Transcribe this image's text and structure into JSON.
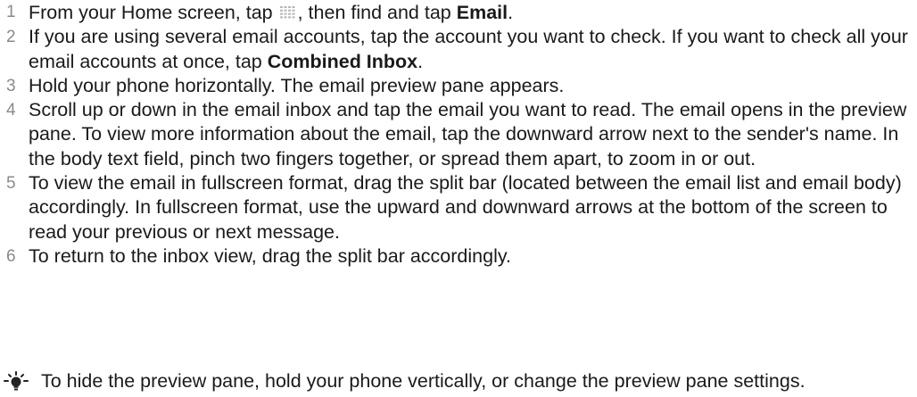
{
  "steps": [
    {
      "number": "1",
      "before_icon": "From your Home screen, tap ",
      "icon": "app-grid-icon",
      "after_icon": ", then find and tap ",
      "bold": "Email",
      "end": "."
    },
    {
      "number": "2",
      "text": "If you are using several email accounts, tap the account you want to check. If you want to check all your email accounts at once, tap ",
      "bold": "Combined Inbox",
      "end": "."
    },
    {
      "number": "3",
      "text": "Hold your phone horizontally. The email preview pane appears."
    },
    {
      "number": "4",
      "text": "Scroll up or down in the email inbox and tap the email you want to read. The email opens in the preview pane. To view more information about the email, tap the downward arrow next to the sender's name. In the body text field, pinch two fingers together, or spread them apart, to zoom in or out."
    },
    {
      "number": "5",
      "text": "To view the email in fullscreen format, drag the split bar (located between the email list and email body) accordingly. In fullscreen format, use the upward and downward arrows at the bottom of the screen to read your previous or next message."
    },
    {
      "number": "6",
      "text": "To return to the inbox view, drag the split bar accordingly."
    }
  ],
  "tip": {
    "icon": "lightbulb-tip-icon",
    "text": "To hide the preview pane, hold your phone vertically, or change the preview pane settings."
  },
  "colors": {
    "step_number": "#8a8a8a",
    "body_text": "#1a1a1a",
    "icon_grid": "#b5b5b5"
  }
}
